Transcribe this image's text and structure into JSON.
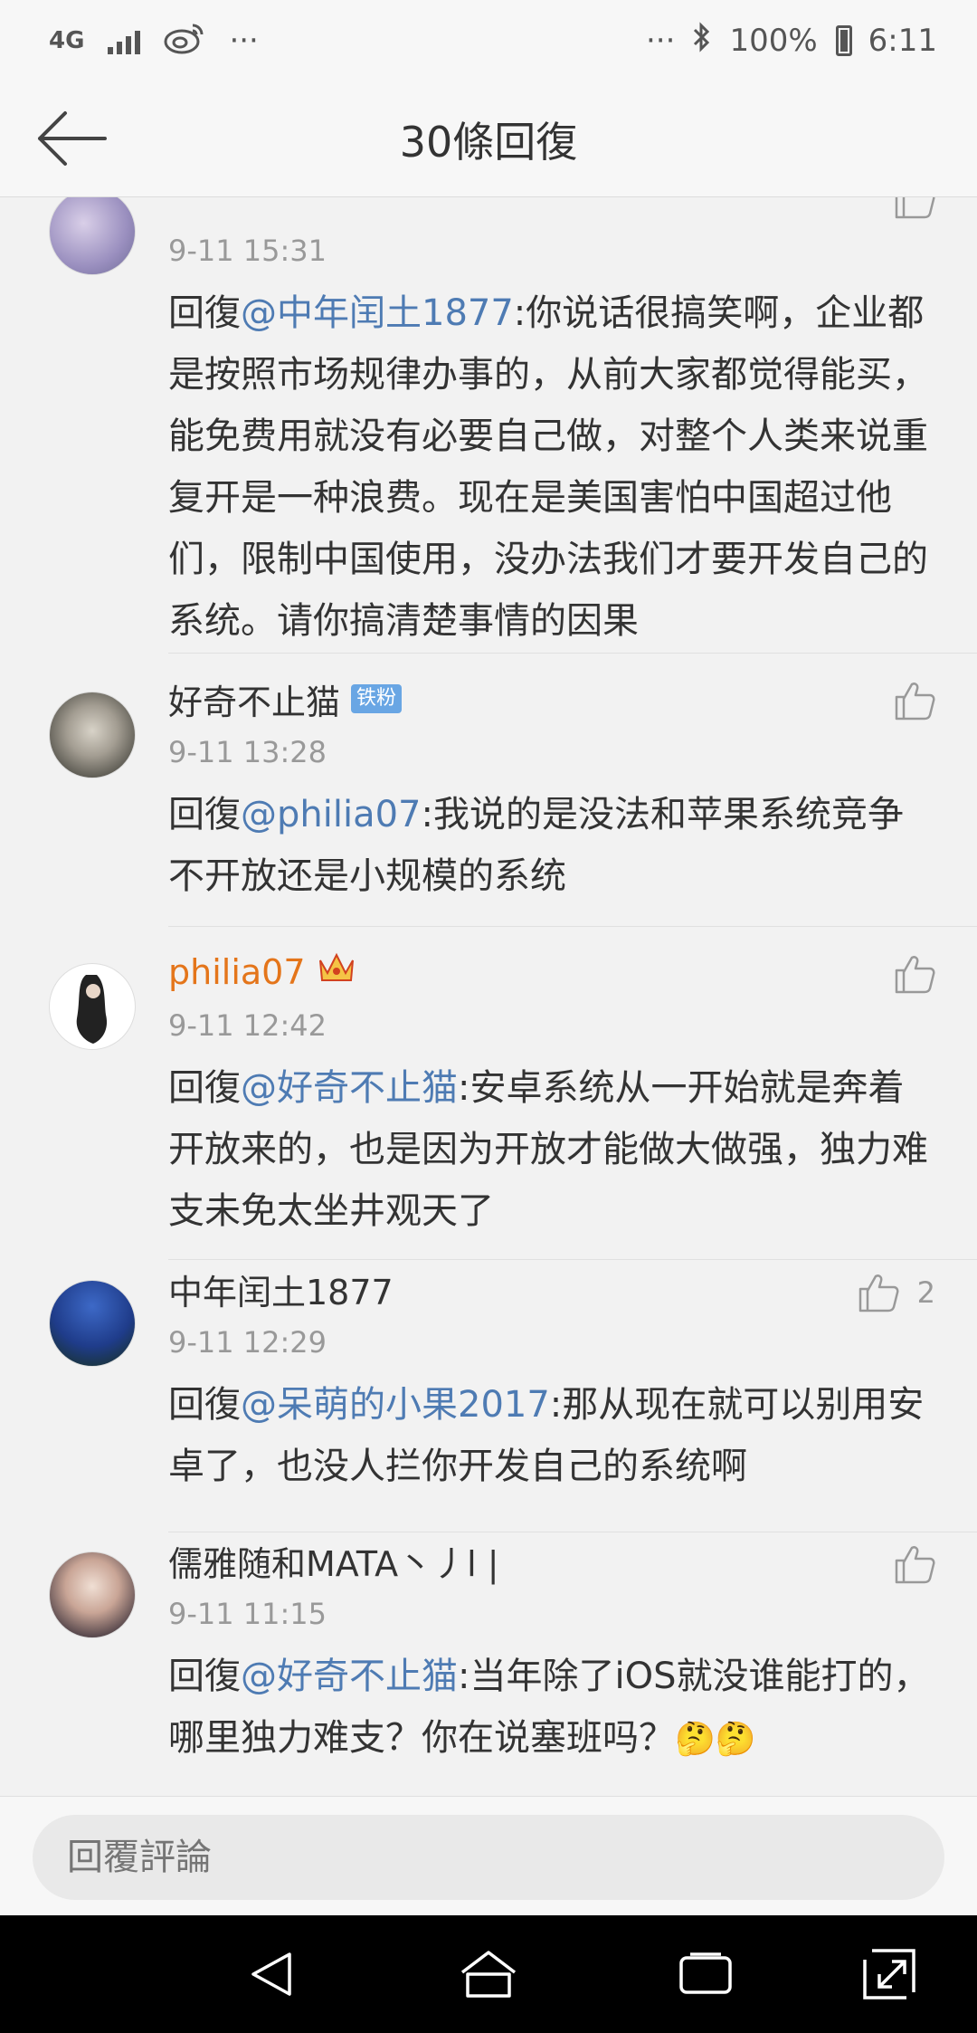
{
  "status_bar": {
    "network": "4G",
    "app_glyph": "weibo-icon",
    "left_more": "···",
    "right_more": "···",
    "bluetooth_glyph": "✱",
    "battery": "100%",
    "time": "6:11"
  },
  "header": {
    "title": "30條回復"
  },
  "comments": [
    {
      "name": "",
      "time": "9-11 15:31",
      "reply_prefix": "回復",
      "mention": "@中年闰土1877",
      "text": ":你说话很搞笑啊，企业都是按照市场规律办事的，从前大家都觉得能买，能免费用就没有必要自己做，对整个人类来说重复开是一种浪费。现在是美国害怕中国超过他们，限制中国使用，没办法我们才要开发自己的系统。请你搞清楚事情的因果"
    },
    {
      "name": "好奇不止猫",
      "badge": "铁粉",
      "time": "9-11 13:28",
      "reply_prefix": "回復",
      "mention": "@philia07",
      "text": ":我说的是没法和苹果系统竞争不开放还是小规模的系统"
    },
    {
      "name": "philia07",
      "time": "9-11 12:42",
      "reply_prefix": "回復",
      "mention": "@好奇不止猫",
      "text": ":安卓系统从一开始就是奔着开放来的，也是因为开放才能做大做强，独力难支未免太坐井观天了"
    },
    {
      "name": "中年闰土1877",
      "time": "9-11 12:29",
      "like_count": "2",
      "reply_prefix": "回復",
      "mention": "@呆萌的小果2017",
      "text": ":那从现在就可以别用安卓了，也没人拦你开发自己的系统啊"
    },
    {
      "name": "儒雅随和MATA丶丿l |",
      "time": "9-11 11:15",
      "reply_prefix": "回復",
      "mention": "@好奇不止猫",
      "text": ":当年除了iOS就没谁能打的，哪里独力难支？你在说塞班吗？",
      "emoji": "🤔🤔"
    }
  ],
  "reply_bar": {
    "placeholder": "回覆評論"
  },
  "colors": {
    "mention": "#4e7bb3",
    "vip_name": "#e4751a",
    "badge": "#69a6e4",
    "time": "#999999"
  }
}
